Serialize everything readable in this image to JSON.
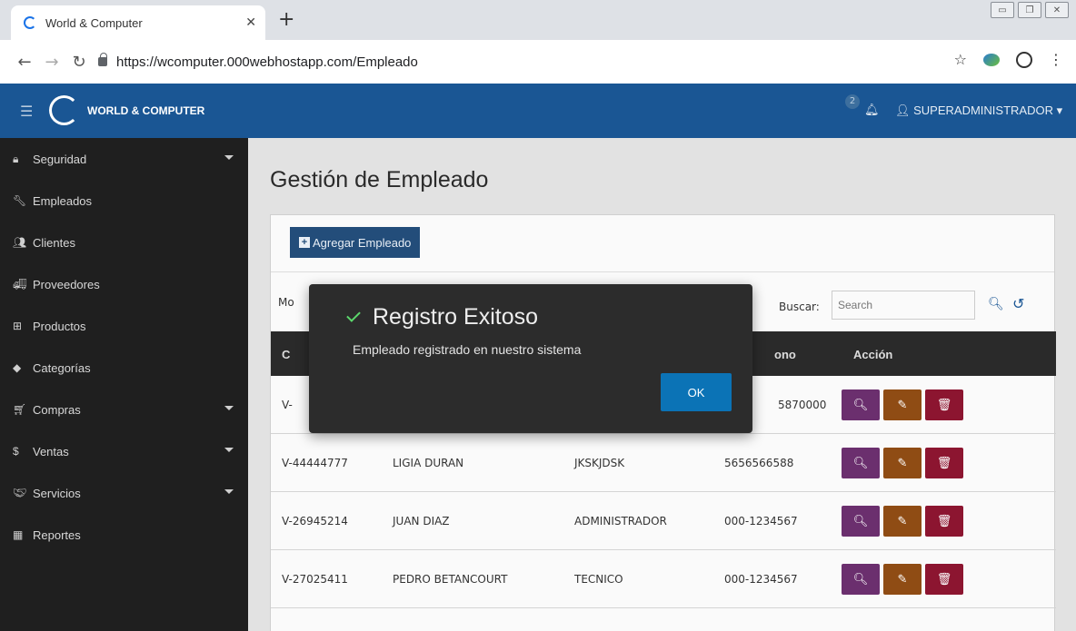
{
  "browser": {
    "tab_title": "World & Computer",
    "tab_close": "✕",
    "new_tab": "+",
    "url": "https://wcomputer.000webhostapp.com/Empleado"
  },
  "header": {
    "brand": "WORLD & COMPUTER",
    "notif_count": "2",
    "user": "SUPERADMINISTRADOR ▾"
  },
  "sidebar": {
    "items": [
      {
        "label": "Seguridad",
        "icon": "lock-icon"
      },
      {
        "label": "Empleados",
        "icon": "wrench-icon"
      },
      {
        "label": "Clientes",
        "icon": "users-icon"
      },
      {
        "label": "Proveedores",
        "icon": "truck-icon"
      },
      {
        "label": "Productos",
        "icon": "sitemap-icon"
      },
      {
        "label": "Categorías",
        "icon": "tag-icon"
      },
      {
        "label": "Compras",
        "icon": "cart-icon"
      },
      {
        "label": "Ventas",
        "icon": "dollar-icon"
      },
      {
        "label": "Servicios",
        "icon": "handshake-icon"
      },
      {
        "label": "Reportes",
        "icon": "calendar-icon"
      }
    ]
  },
  "main": {
    "title": "Gestión de Empleado",
    "add_button": "Agregar Empleado",
    "show_label": "Mo",
    "search_label": "Buscar:",
    "search_placeholder": "Search",
    "columns": {
      "c1": "C",
      "c4": "ono",
      "action": "Acción"
    },
    "rows": [
      {
        "cedula": "V-",
        "nombre": "",
        "cargo": "",
        "telefono": "5870000"
      },
      {
        "cedula": "V-44444777",
        "nombre": "LIGIA DURAN",
        "cargo": "JKSKJDSK",
        "telefono": "5656566588"
      },
      {
        "cedula": "V-26945214",
        "nombre": "JUAN DIAZ",
        "cargo": "ADMINISTRADOR",
        "telefono": "000-1234567"
      },
      {
        "cedula": "V-27025411",
        "nombre": "PEDRO BETANCOURT",
        "cargo": "TECNICO",
        "telefono": "000-1234567"
      }
    ]
  },
  "modal": {
    "title": "Registro Exitoso",
    "message": "Empleado registrado en nuestro sistema",
    "ok": "OK"
  },
  "colors": {
    "header_bg": "#1a5694",
    "sidebar_bg": "#1f1f1f",
    "modal_bg": "#2c2c2c",
    "ok_button": "#0b73b6",
    "view_button": "#6b2f6e",
    "edit_button": "#8f4c14",
    "delete_button": "#8c1530"
  }
}
